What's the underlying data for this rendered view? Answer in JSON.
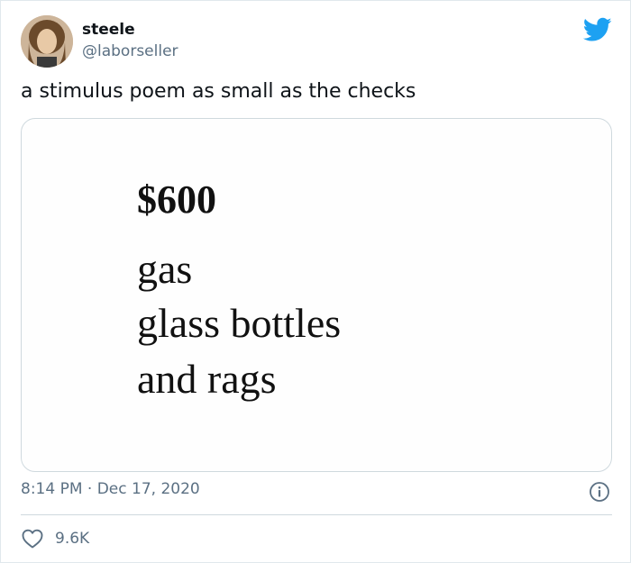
{
  "author": {
    "display_name": "steele",
    "handle": "@laborseller"
  },
  "tweet": {
    "text": "a stimulus poem as small as the checks",
    "time": "8:14 PM",
    "separator": " · ",
    "date": "Dec 17, 2020"
  },
  "poem": {
    "title": "$600",
    "lines": [
      "gas",
      "glass bottles",
      "and rags"
    ]
  },
  "engagement": {
    "likes": "9.6K"
  },
  "colors": {
    "twitter_blue": "#1da1f2",
    "text_primary": "#0f1419",
    "text_secondary": "#5b7083",
    "border": "#cfd9de"
  },
  "icons": {
    "logo": "twitter-bird-icon",
    "info": "info-icon",
    "like": "heart-outline-icon"
  }
}
